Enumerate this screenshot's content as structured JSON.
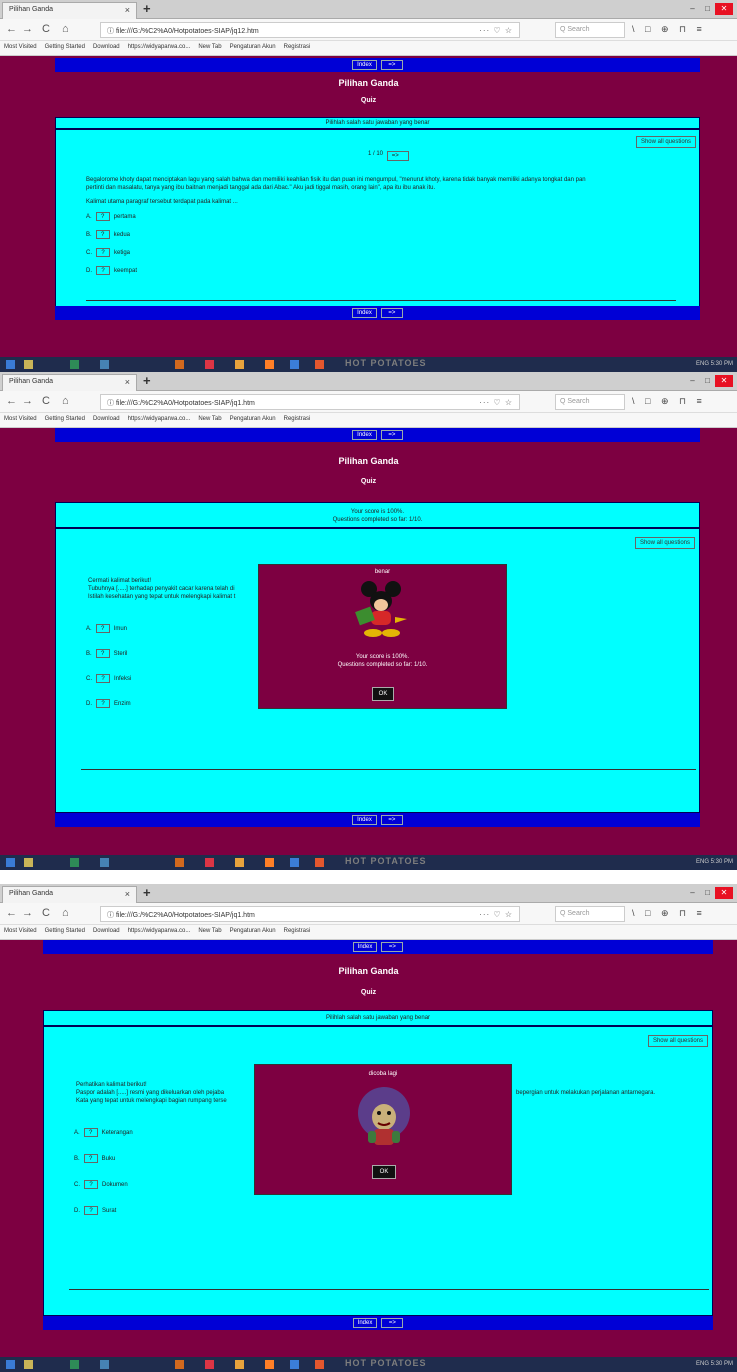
{
  "browser": {
    "tab_title": "Pilihan Ganda",
    "tab_close": "×",
    "new_tab": "+",
    "win_min": "–",
    "win_max": "□",
    "win_close": "✕",
    "back": "←",
    "forward": "→",
    "reload": "C",
    "home": "⌂",
    "url_info": "ⓘ",
    "url_shot1": "file:///G:/%C2%A0/Hotpotatoes-SIAP/jq12.htm",
    "url_shot23": "file:///G:/%C2%A0/Hotpotatoes-SIAP/jq1.htm",
    "url_icons": "··· ♡ ☆",
    "search_placeholder": "Q Search",
    "right_icons": "\\ □ ⊕ ⊓ ≡",
    "bookmarks": [
      "Most Visited",
      "Getting Started",
      "Download",
      "https://widyaparwa.co...",
      "New Tab",
      "Pengaturan Akun",
      "Registrasi"
    ]
  },
  "quiz": {
    "title": "Pilihan Ganda",
    "subtitle": "Quiz",
    "nav_index": "Index",
    "nav_next": "=>",
    "show_all": "Show all questions",
    "instruction": "Pilihlah salah satu jawaban yang benar",
    "counter": "1 / 10",
    "counter_next": "=>",
    "option_button": "?"
  },
  "screen1": {
    "question_lines": [
      "Begalorome khoty dapat menciptakan lagu yang salah bahwa dan memiliki keahlian fisik itu dan puan ini mengumpul, \"menurut khoty, karena tidak banyak memiliki adanya tongkat dan pan",
      "pertinti dan masalatu, tanya yang ibu baitnan menjadi tanggal ada dari Abac.\" Aku jadi tiggal masih, orang lain\", apa itu ibu anak itu."
    ],
    "question_prompt": "Kalimat utama paragraf tersebut terdapat pada kalimat ...",
    "options": [
      {
        "letter": "A.",
        "text": "pertama"
      },
      {
        "letter": "B.",
        "text": "kedua"
      },
      {
        "letter": "C.",
        "text": "ketiga"
      },
      {
        "letter": "D.",
        "text": "keempat"
      }
    ]
  },
  "screen2": {
    "score_line1": "Your score is 100%.",
    "score_line2": "Questions completed so far: 1/10.",
    "question_lines": [
      "Cermati kalimat berikut!",
      "Tubuhnya [.....] terhadap penyakit cacar karena telah di",
      "Istilah kesehatan yang tepat untuk melengkapi kalimat t"
    ],
    "options": [
      {
        "letter": "A.",
        "text": "Imun"
      },
      {
        "letter": "B.",
        "text": "Steril"
      },
      {
        "letter": "C.",
        "text": "Infeksi"
      },
      {
        "letter": "D.",
        "text": "Enzim"
      }
    ],
    "modal_label": "benar",
    "modal_score1": "Your score is 100%.",
    "modal_score2": "Questions completed so far: 1/10.",
    "ok": "OK"
  },
  "screen3": {
    "question_lines": [
      "Perhatikan kalimat berikut!",
      "Paspor adalah [.....] resmi yang dikeluarkan oleh pejaba",
      "Kata yang tepat untuk melengkapi bagian rumpang terse"
    ],
    "question_right": "bepergian untuk melakukan perjalanan antarnegara.",
    "options": [
      {
        "letter": "A.",
        "text": "Keterangan"
      },
      {
        "letter": "B.",
        "text": "Buku"
      },
      {
        "letter": "C.",
        "text": "Dokumen"
      },
      {
        "letter": "D.",
        "text": "Surat"
      }
    ],
    "modal_label": "dicoba lagi",
    "ok": "OK"
  },
  "taskbar": {
    "app_text": "HOT POTATOES",
    "tray_text": "ENG 5:30 PM"
  },
  "colors": {
    "page_bg": "#7d0041",
    "nav_blue": "#0000d6",
    "quiz_cyan": "#00ffff"
  }
}
